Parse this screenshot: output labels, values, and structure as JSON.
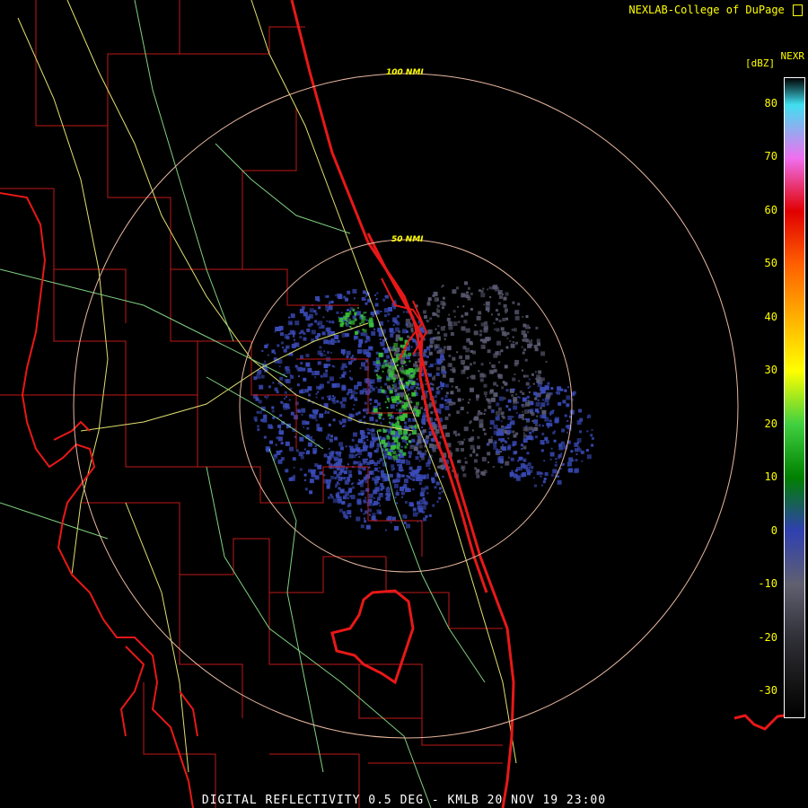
{
  "header": {
    "credit": "NEXLAB-College of DuPage",
    "credit_logo_icon": "cod-logo-icon",
    "product": "NEXR",
    "units": "[dBZ]"
  },
  "rings": [
    {
      "label": "100 NMI"
    },
    {
      "label": "50 NMI"
    }
  ],
  "legend": {
    "ticks": [
      "80",
      "70",
      "60",
      "50",
      "40",
      "30",
      "20",
      "10",
      "0",
      "-10",
      "-20",
      "-30"
    ],
    "colors": {
      "80": "#40e0f0",
      "70": "#f070f0",
      "60": "#e00000",
      "50": "#ff6000",
      "40": "#ffb000",
      "30": "#ffff00",
      "20": "#40d040",
      "10": "#008000",
      "0": "#3040b0",
      "-10": "#606070",
      "-20": "#303038",
      "-30": "#101010"
    }
  },
  "footer": {
    "caption": "DIGITAL REFLECTIVITY 0.5 DEG - KMLB 20 NOV 19 23:00"
  },
  "map_colors": {
    "coast": "#e81818",
    "county": "#c01818",
    "road": "#e0e070",
    "road_minor": "#80d080",
    "ring": "#e8b8a0"
  }
}
